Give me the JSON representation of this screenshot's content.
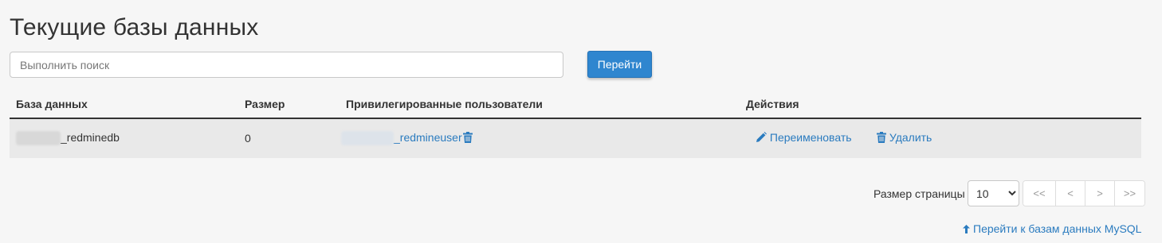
{
  "page": {
    "title": "Текущие базы данных"
  },
  "search": {
    "placeholder": "Выполнить поиск",
    "button_label": "Перейти"
  },
  "table": {
    "headers": {
      "database": "База данных",
      "size": "Размер",
      "privileged_users": "Привилегированные пользователи",
      "actions": "Действия"
    },
    "rows": [
      {
        "database": "_redminedb",
        "size": "0",
        "user": "_redmineuser",
        "rename_label": "Переименовать",
        "delete_label": "Удалить"
      }
    ]
  },
  "pagination": {
    "page_size_label": "Размер страницы",
    "page_size_value": "10",
    "page_size_options": [
      "10"
    ],
    "first": "<<",
    "prev": "<",
    "next": ">",
    "last": ">>"
  },
  "footer": {
    "mysql_link": "Перейти к базам данных MySQL"
  },
  "colors": {
    "accent": "#2f86cf",
    "link": "#2a7bbf",
    "row_bg": "#e9e9e9",
    "page_bg": "#f6f6f6"
  },
  "icons": [
    "trash-icon",
    "pencil-icon",
    "arrow-up-icon"
  ]
}
